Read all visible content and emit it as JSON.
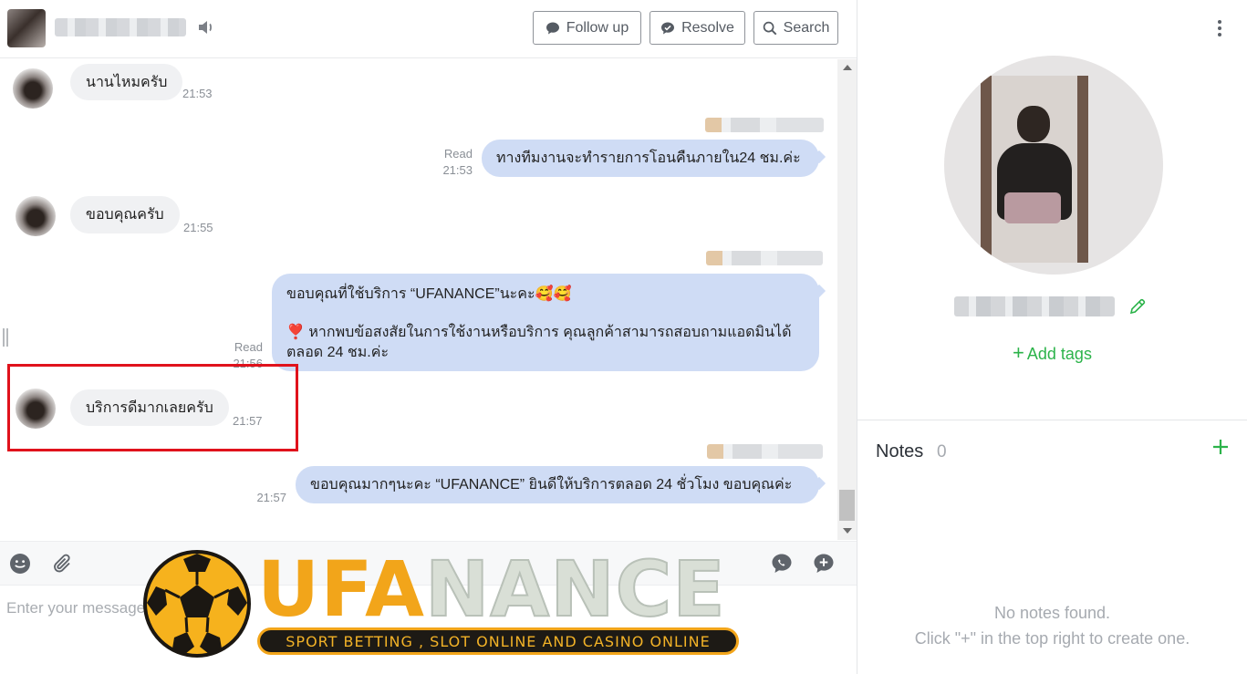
{
  "header": {
    "follow_up_label": "Follow up",
    "resolve_label": "Resolve",
    "search_label": "Search"
  },
  "messages": [
    {
      "direction": "in",
      "text": "นานไหมครับ",
      "time": "21:53"
    },
    {
      "direction": "out",
      "text": "ทางทีมงานจะทำรายการโอนคืนภายใน24 ชม.ค่ะ",
      "status": "Read",
      "time": "21:53"
    },
    {
      "direction": "in",
      "text": "ขอบคุณครับ",
      "time": "21:55"
    },
    {
      "direction": "out",
      "line1": "ขอบคุณที่ใช้บริการ “UFANANCE”นะคะ🥰🥰",
      "line2": "❣️ หากพบข้อสงสัยในการใช้งานหรือบริการ คุณลูกค้าสามารถสอบถามแอดมินได้ตลอด 24 ชม.ค่ะ",
      "status": "Read",
      "time": "21:56"
    },
    {
      "direction": "in",
      "text": "บริการดีมากเลยครับ",
      "time": "21:57"
    },
    {
      "direction": "out",
      "text": "ขอบคุณมากๆนะคะ “UFANANCE” ยินดีให้บริการตลอด 24 ชั่วโมง ขอบคุณค่ะ",
      "time": "21:57"
    }
  ],
  "composer": {
    "placeholder": "Enter your message"
  },
  "profile": {
    "add_tags_label": "Add tags"
  },
  "notes": {
    "title": "Notes",
    "count": "0",
    "empty_line1": "No notes found.",
    "empty_line2": "Click \"+\" in the top right to create one."
  },
  "watermark": {
    "brand_part1": "UFA",
    "brand_part2": "NANCE",
    "tagline": "SPORT BETTING , SLOT ONLINE AND CASINO ONLINE"
  },
  "colors": {
    "accent_green": "#2cb34a",
    "outgoing_bubble": "#cfdcf5",
    "incoming_bubble": "#f0f1f3",
    "highlight_red": "#e0121c",
    "brand_orange": "#f2a51a"
  },
  "icons": [
    "speaker-icon",
    "chat-bubble-icon",
    "check-bubble-icon",
    "search-icon",
    "emoji-icon",
    "paperclip-icon",
    "quick-reply-icon",
    "add-chat-icon",
    "kebab-menu-icon",
    "pencil-icon",
    "plus-icon",
    "soccer-ball-icon"
  ]
}
